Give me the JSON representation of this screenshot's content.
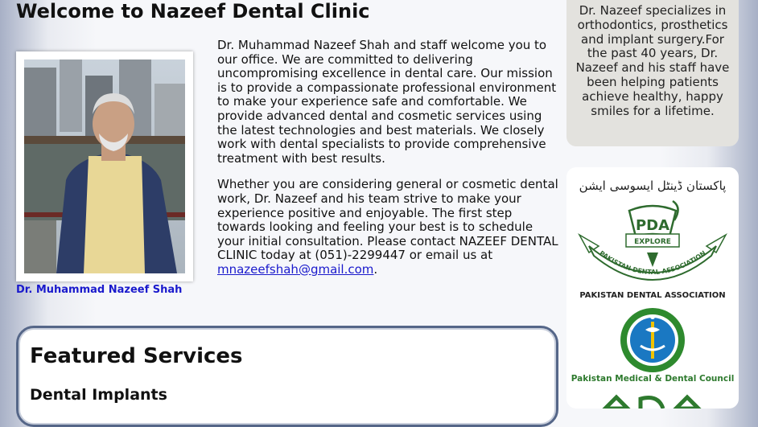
{
  "page": {
    "title": "Welcome to Nazeef Dental Clinic"
  },
  "profile": {
    "caption": "Dr. Muhammad Nazeef Shah"
  },
  "intro": {
    "paragraph1": "Dr. Muhammad Nazeef Shah and staff welcome you to our office. We are committed to delivering uncompromising excellence in dental care. Our mission is to provide a compassionate professional environment to make your experience safe and comfortable. We provide advanced dental and cosmetic services using the latest technologies and best materials. We closely work with dental specialists to provide comprehensive treatment with best results.",
    "paragraph2_before": "Whether you are considering general or cosmetic dental work, Dr. Nazeef and his team strive to make your experience positive and enjoyable. The first step towards looking and feeling your best is to schedule your initial consultation. Please contact NAZEEF DENTAL CLINIC today at (051)-2299447 or email us at ",
    "email": "mnazeefshah@gmail.com",
    "paragraph2_after": "."
  },
  "featured": {
    "heading": "Featured Services",
    "first_service": "Dental Implants"
  },
  "sidebar": {
    "about": "Dr. Nazeef specializes in orthodontics, prosthetics and implant surgery.For the past 40 years, Dr. Nazeef and his staff have been helping patients achieve healthy, happy smiles for a lifetime.",
    "pda": {
      "urdu": "پاکستان ڈینٹل ایسوسی ایشن",
      "badge": "PDA",
      "ribbon": "EXPLORE",
      "arc": "PAKISTAN DENTAL ASSOCIATION",
      "caption": "PAKISTAN DENTAL ASSOCIATION"
    },
    "pmdc": {
      "caption": "Pakistan Medical & Dental Council"
    }
  },
  "colors": {
    "link": "#1a1acc",
    "pda_green": "#2e6b2e",
    "pmdc_blue": "#1a78c2",
    "pmdc_green": "#2e7a2e"
  }
}
